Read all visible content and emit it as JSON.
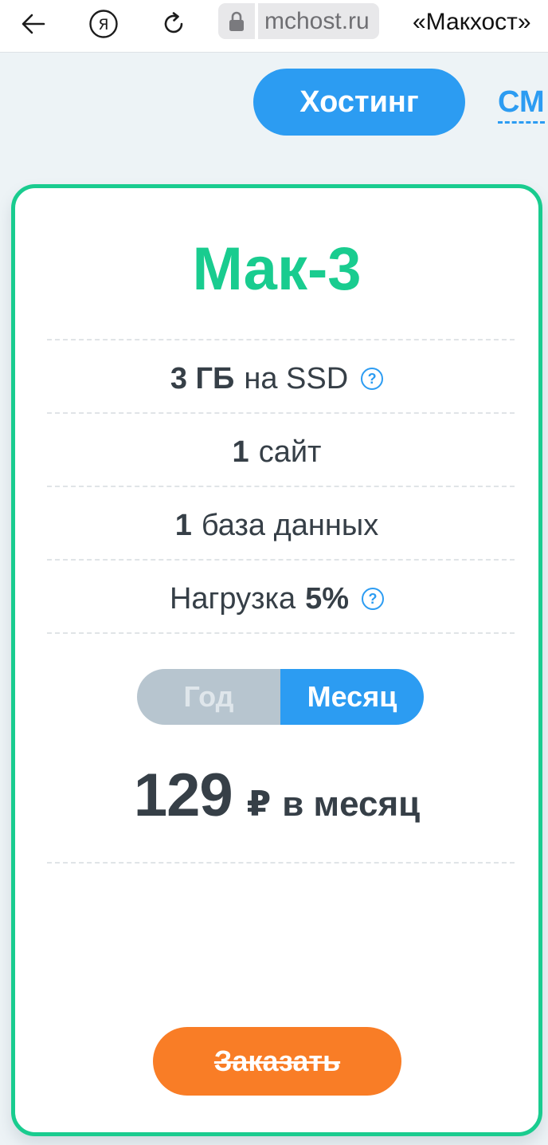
{
  "browser": {
    "domain": "mchost.ru",
    "page_title": "«Макхост»",
    "icons": [
      "back-arrow-icon",
      "yandex-icon",
      "reload-icon",
      "lock-icon"
    ]
  },
  "tabs": {
    "hosting_label": "Хостинг",
    "cms_label": "СМ"
  },
  "plan": {
    "title": "Мак-3",
    "features": [
      {
        "value": "3 ГБ",
        "text": "на SSD",
        "has_help": true
      },
      {
        "value": "1",
        "text": "сайт",
        "has_help": false
      },
      {
        "value": "1",
        "text": "база данных",
        "has_help": false
      },
      {
        "prefix": "Нагрузка",
        "value": "5%",
        "has_help": true
      }
    ],
    "help_mark": "?",
    "period": {
      "year_label": "Год",
      "month_label": "Месяц",
      "selected": "Месяц"
    },
    "price": {
      "value": "129",
      "currency": "₽",
      "period": "в месяц"
    },
    "order_label": "Заказать"
  },
  "colors": {
    "accent_blue": "#2c9cf2",
    "accent_green": "#19cc8f",
    "order_orange": "#f97d26",
    "toggle_inactive": "#b7c5cf",
    "background": "#edf3f6"
  }
}
